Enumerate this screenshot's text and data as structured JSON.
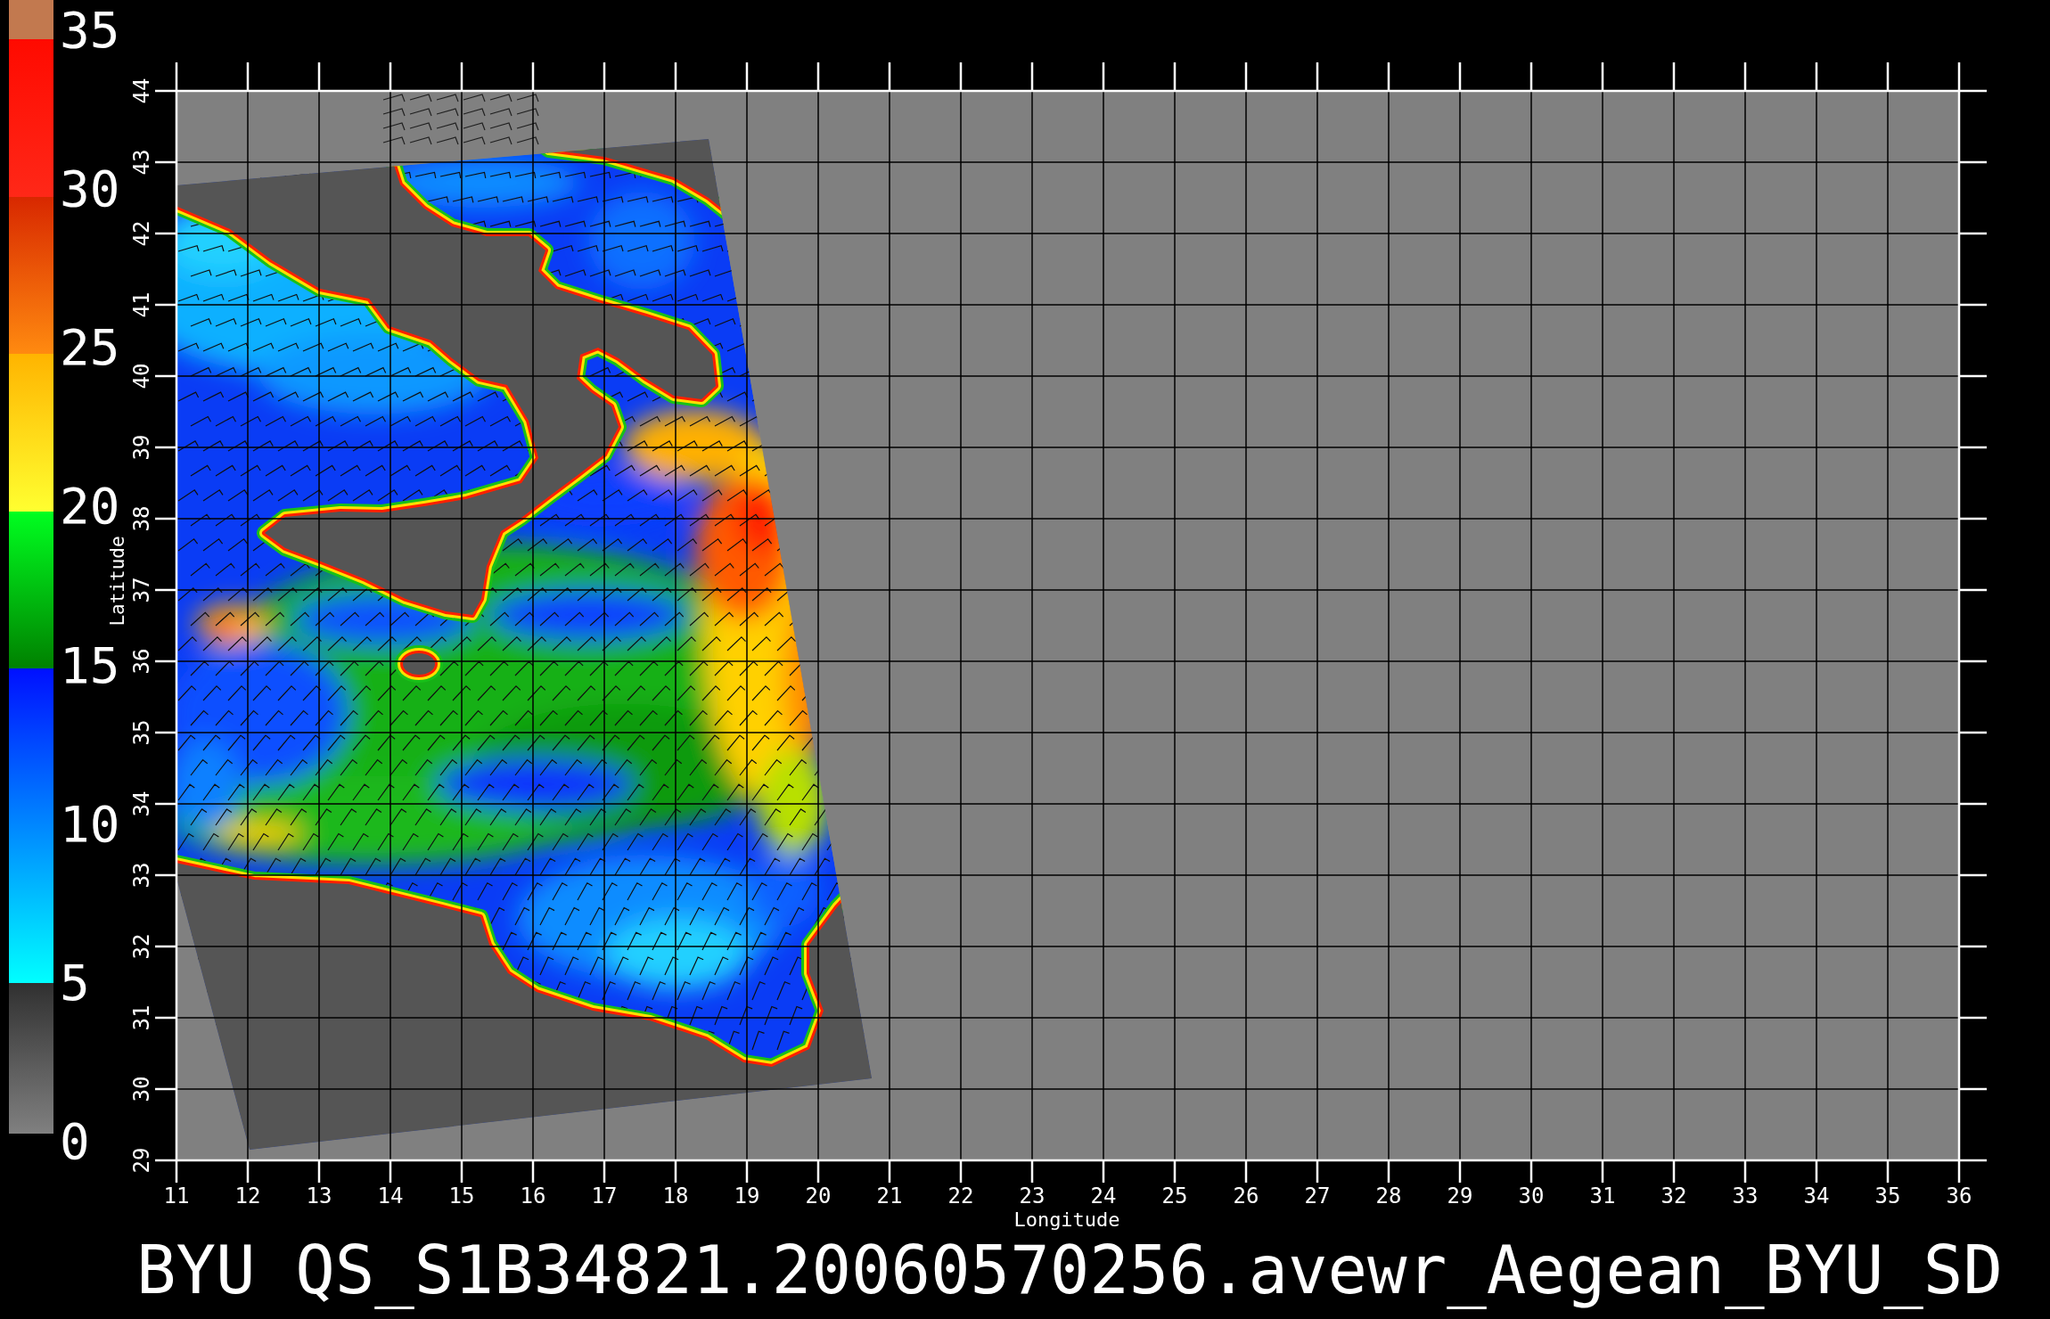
{
  "color_scale": {
    "labels": [
      "35",
      "30",
      "25",
      "20",
      "15",
      "10",
      "5",
      "0"
    ]
  },
  "map": {
    "ylabel": "Latitude",
    "latitude_ticks": [
      "44",
      "43",
      "42",
      "41",
      "40",
      "39",
      "38",
      "37",
      "36",
      "35",
      "34",
      "33",
      "32",
      "31",
      "30",
      "29"
    ],
    "longitude_ticks": [
      "11",
      "12",
      "13",
      "14",
      "15",
      "16",
      "17",
      "18",
      "19",
      "20",
      "21",
      "22",
      "23",
      "24",
      "25",
      "26",
      "27",
      "28",
      "29",
      "30",
      "31",
      "32",
      "33",
      "34",
      "35",
      "36"
    ],
    "xlabel": "Longitude"
  },
  "title": "BYU QS_S1B34821.20060570256.avewr_Aegean_BYU_SD"
}
